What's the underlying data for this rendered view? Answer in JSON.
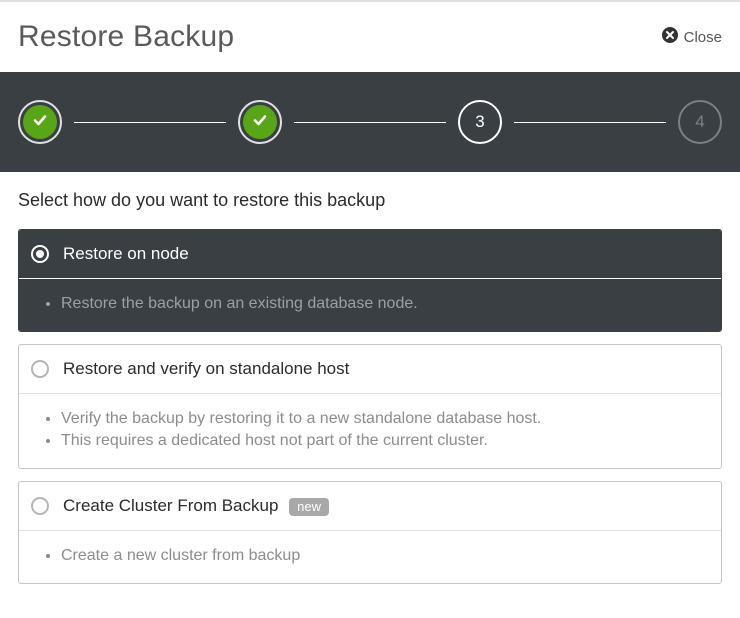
{
  "header": {
    "title": "Restore Backup",
    "close_label": "Close"
  },
  "stepper": {
    "steps": [
      {
        "state": "done"
      },
      {
        "state": "done"
      },
      {
        "state": "current",
        "label": "3"
      },
      {
        "state": "future",
        "label": "4"
      }
    ]
  },
  "prompt": "Select how do you want to restore this backup",
  "options": [
    {
      "id": "restore-on-node",
      "title": "Restore on node",
      "selected": true,
      "badge": null,
      "bullets": [
        "Restore the backup on an existing database node."
      ]
    },
    {
      "id": "restore-verify-standalone",
      "title": "Restore and verify on standalone host",
      "selected": false,
      "badge": null,
      "bullets": [
        "Verify the backup by restoring it to a new standalone database host.",
        "This requires a dedicated host not part of the current cluster."
      ]
    },
    {
      "id": "create-cluster-from-backup",
      "title": "Create Cluster From Backup",
      "selected": false,
      "badge": "new",
      "bullets": [
        "Create a new cluster from backup"
      ]
    }
  ]
}
